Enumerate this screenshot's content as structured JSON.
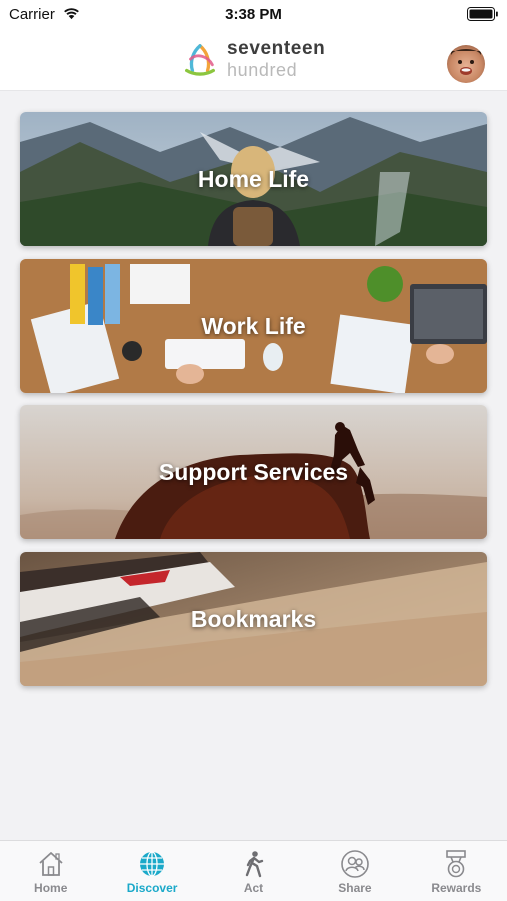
{
  "status_bar": {
    "carrier": "Carrier",
    "time": "3:38 PM"
  },
  "header": {
    "brand_line1": "seventeen",
    "brand_line2": "hundred"
  },
  "cards": [
    {
      "title": "Home Life"
    },
    {
      "title": "Work Life"
    },
    {
      "title": "Support Services"
    },
    {
      "title": "Bookmarks"
    }
  ],
  "tabs": [
    {
      "label": "Home",
      "icon": "house-icon",
      "active": false
    },
    {
      "label": "Discover",
      "icon": "globe-icon",
      "active": true
    },
    {
      "label": "Act",
      "icon": "walking-person-icon",
      "active": false
    },
    {
      "label": "Share",
      "icon": "people-icon",
      "active": false
    },
    {
      "label": "Rewards",
      "icon": "medal-icon",
      "active": false
    }
  ],
  "colors": {
    "accent": "#1ba9c9",
    "inactive": "#8a8a8e",
    "background": "#f2f2f4"
  }
}
